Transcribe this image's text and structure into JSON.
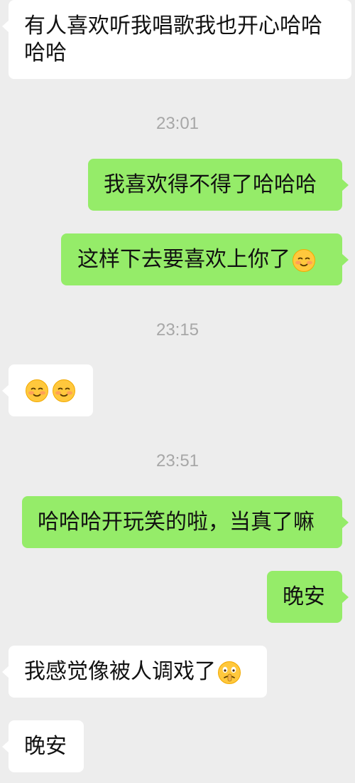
{
  "messages": [
    {
      "side": "left",
      "text": "有人喜欢听我唱歌我也开心哈哈哈哈"
    },
    {
      "side": "right",
      "text": "我喜欢得不得了哈哈哈"
    },
    {
      "side": "right",
      "text": "这样下去要喜欢上你了",
      "emoji": "blush-smile-icon"
    },
    {
      "side": "left",
      "emoji_only": [
        "blush-smile-icon",
        "blush-smile-icon"
      ]
    },
    {
      "side": "right",
      "text": "哈哈哈开玩笑的啦，当真了嘛"
    },
    {
      "side": "right",
      "text": "晚安"
    },
    {
      "side": "left",
      "text": "我感觉像被人调戏了",
      "emoji": "shush-face-icon"
    },
    {
      "side": "left",
      "text": "晚安"
    }
  ],
  "timestamps": [
    "23:01",
    "23:15",
    "23:51"
  ],
  "colors": {
    "background": "#ededed",
    "incoming_bubble": "#ffffff",
    "outgoing_bubble": "#95ec69",
    "timestamp": "#a7a7a7"
  }
}
